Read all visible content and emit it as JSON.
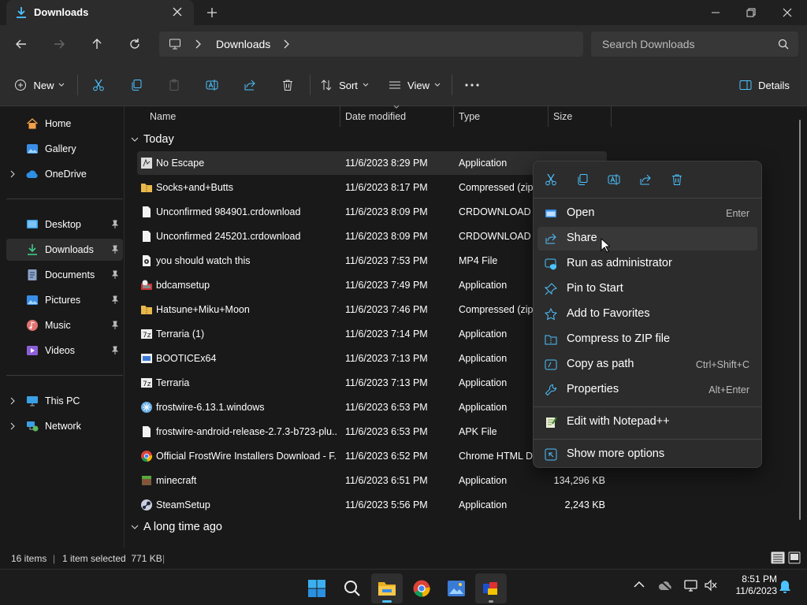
{
  "window": {
    "tab_title": "Downloads"
  },
  "nav": {
    "breadcrumb": "Downloads",
    "search_placeholder": "Search Downloads"
  },
  "toolbar": {
    "new_label": "New",
    "sort_label": "Sort",
    "view_label": "View",
    "details_label": "Details"
  },
  "sidebar": {
    "items": [
      {
        "label": "Home"
      },
      {
        "label": "Gallery"
      },
      {
        "label": "OneDrive"
      },
      {
        "label": "Desktop"
      },
      {
        "label": "Downloads"
      },
      {
        "label": "Documents"
      },
      {
        "label": "Pictures"
      },
      {
        "label": "Music"
      },
      {
        "label": "Videos"
      },
      {
        "label": "This PC"
      },
      {
        "label": "Network"
      }
    ]
  },
  "columns": {
    "name": "Name",
    "date": "Date modified",
    "type": "Type",
    "size": "Size"
  },
  "groups": {
    "today": "Today",
    "older": "A long time ago"
  },
  "files": [
    {
      "name": "No Escape",
      "date": "11/6/2023 8:29 PM",
      "type": "Application",
      "size": ""
    },
    {
      "name": "Socks+and+Butts",
      "date": "11/6/2023 8:17 PM",
      "type": "Compressed (zipp",
      "size": ""
    },
    {
      "name": "Unconfirmed 984901.crdownload",
      "date": "11/6/2023 8:09 PM",
      "type": "CRDOWNLOAD F",
      "size": ""
    },
    {
      "name": "Unconfirmed 245201.crdownload",
      "date": "11/6/2023 8:09 PM",
      "type": "CRDOWNLOAD F",
      "size": ""
    },
    {
      "name": "you should watch this",
      "date": "11/6/2023 7:53 PM",
      "type": "MP4 File",
      "size": ""
    },
    {
      "name": "bdcamsetup",
      "date": "11/6/2023 7:49 PM",
      "type": "Application",
      "size": ""
    },
    {
      "name": "Hatsune+Miku+Moon",
      "date": "11/6/2023 7:46 PM",
      "type": "Compressed (zipp",
      "size": ""
    },
    {
      "name": "Terraria (1)",
      "date": "11/6/2023 7:14 PM",
      "type": "Application",
      "size": ""
    },
    {
      "name": "BOOTICEx64",
      "date": "11/6/2023 7:13 PM",
      "type": "Application",
      "size": ""
    },
    {
      "name": "Terraria",
      "date": "11/6/2023 7:13 PM",
      "type": "Application",
      "size": ""
    },
    {
      "name": "frostwire-6.13.1.windows",
      "date": "11/6/2023 6:53 PM",
      "type": "Application",
      "size": ""
    },
    {
      "name": "frostwire-android-release-2.7.3-b723-plu...",
      "date": "11/6/2023 6:53 PM",
      "type": "APK File",
      "size": ""
    },
    {
      "name": "Official FrostWire Installers Download - F...",
      "date": "11/6/2023 6:52 PM",
      "type": "Chrome HTML Do",
      "size": ""
    },
    {
      "name": "minecraft",
      "date": "11/6/2023 6:51 PM",
      "type": "Application",
      "size": "134,296 KB"
    },
    {
      "name": "SteamSetup",
      "date": "11/6/2023 5:56 PM",
      "type": "Application",
      "size": "2,243 KB"
    }
  ],
  "context_menu": {
    "items": [
      {
        "label": "Open",
        "shortcut": "Enter"
      },
      {
        "label": "Share",
        "shortcut": ""
      },
      {
        "label": "Run as administrator",
        "shortcut": ""
      },
      {
        "label": "Pin to Start",
        "shortcut": ""
      },
      {
        "label": "Add to Favorites",
        "shortcut": ""
      },
      {
        "label": "Compress to ZIP file",
        "shortcut": ""
      },
      {
        "label": "Copy as path",
        "shortcut": "Ctrl+Shift+C"
      },
      {
        "label": "Properties",
        "shortcut": "Alt+Enter"
      },
      {
        "label": "Edit with Notepad++",
        "shortcut": ""
      },
      {
        "label": "Show more options",
        "shortcut": ""
      }
    ]
  },
  "status": {
    "item_count": "16 items",
    "selection": "1 item selected  771 KB"
  },
  "clock": {
    "time": "8:51 PM",
    "date": "11/6/2023"
  },
  "colors": {
    "accent": "#4cc2ff",
    "background": "#191919",
    "menu_bg": "#2c2c2c"
  }
}
